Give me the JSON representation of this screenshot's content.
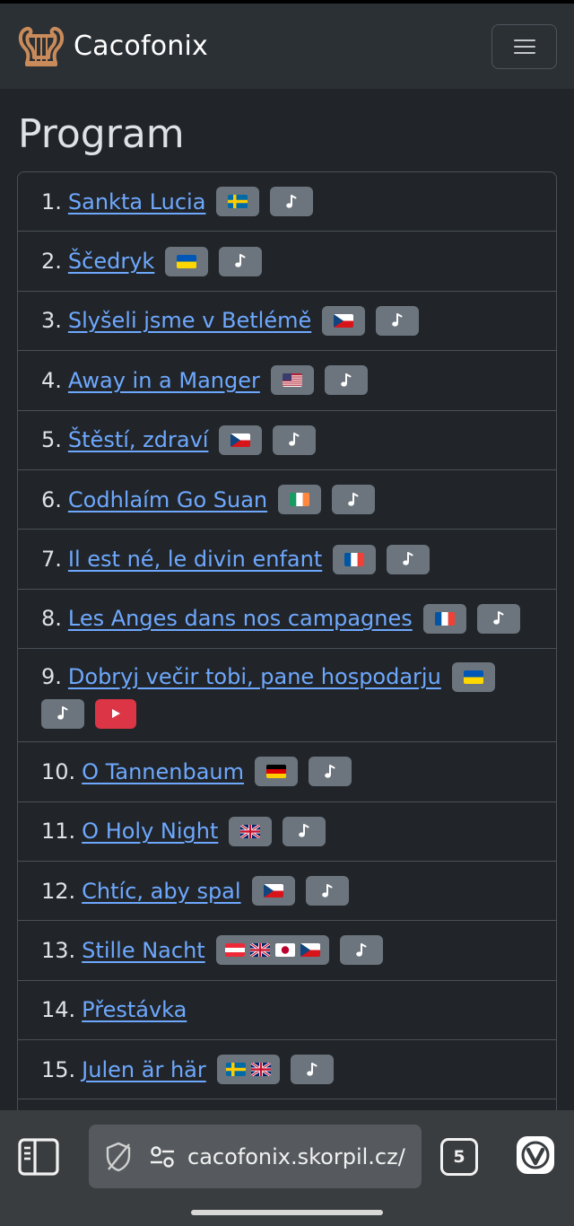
{
  "navbar": {
    "brand": "Cacofonix"
  },
  "page": {
    "title": "Program"
  },
  "program": [
    {
      "num": "1.",
      "title": "Sankta Lucia",
      "flags": [
        "se"
      ]
    },
    {
      "num": "2.",
      "title": "Ščedryk",
      "flags": [
        "ua"
      ]
    },
    {
      "num": "3.",
      "title": "Slyšeli jsme v Betlémě",
      "flags": [
        "cz"
      ]
    },
    {
      "num": "4.",
      "title": "Away in a Manger",
      "flags": [
        "us"
      ]
    },
    {
      "num": "5.",
      "title": "Štěstí, zdraví",
      "flags": [
        "cz"
      ]
    },
    {
      "num": "6.",
      "title": "Codhlaím Go Suan",
      "flags": [
        "ie"
      ]
    },
    {
      "num": "7.",
      "title": "Il est né, le divin enfant",
      "flags": [
        "fr"
      ]
    },
    {
      "num": "8.",
      "title": "Les Anges dans nos campagnes",
      "flags": [
        "fr"
      ]
    },
    {
      "num": "9.",
      "title": "Dobryj večir tobi, pane hospodarju",
      "flags": [
        "ua"
      ],
      "video": true
    },
    {
      "num": "10.",
      "title": "O Tannenbaum",
      "flags": [
        "de"
      ]
    },
    {
      "num": "11.",
      "title": "O Holy Night",
      "flags": [
        "gb"
      ]
    },
    {
      "num": "12.",
      "title": "Chtíc, aby spal",
      "flags": [
        "cz"
      ]
    },
    {
      "num": "13.",
      "title": "Stille Nacht",
      "flags": [
        "at",
        "gb",
        "jp",
        "cz"
      ]
    },
    {
      "num": "14.",
      "title": "Přestávka",
      "flags": [],
      "noAudio": true
    },
    {
      "num": "15.",
      "title": "Julen är här",
      "flags": [
        "se",
        "gb"
      ]
    }
  ],
  "browser": {
    "url": "cacofonix.skorpil.cz/",
    "tab_count": "5"
  },
  "icons": {
    "flag_badge": "flag-icon",
    "audio_badge": "music-note-icon",
    "video_badge": "play-icon"
  },
  "colors": {
    "background": "#212529",
    "navbar": "#2b3035",
    "link": "#6ea8fe",
    "badge": "#6c757d",
    "video_badge": "#dc3545"
  }
}
